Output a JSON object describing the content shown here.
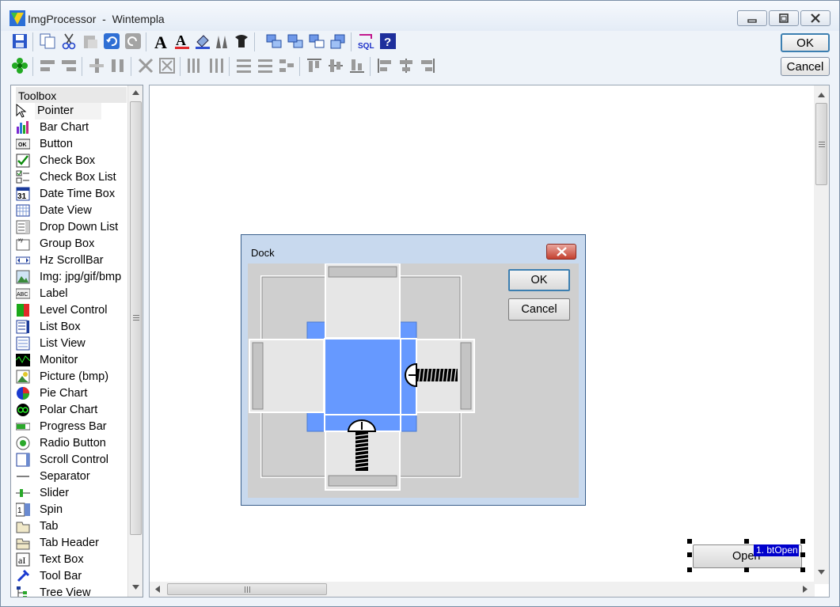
{
  "window": {
    "title": "ImgProcessor  -  Wintempla",
    "controls": [
      "minimize-icon",
      "maximize-icon",
      "close-icon"
    ]
  },
  "toolbar_row1": [
    "save-icon",
    "copy-icon",
    "cut-icon",
    "paste-icon",
    "undo-icon",
    "redo-icon",
    "font-icon",
    "font-color-icon",
    "fill-icon",
    "pen-icon",
    "eraser-icon",
    "bring-front-icon",
    "send-back-icon",
    "swap-icon",
    "move-icon",
    "sql-icon",
    "help-icon"
  ],
  "toolbar_row2": [
    "flower-icon",
    "align-left-edges-icon",
    "align-right-edges-icon",
    "center-horz-icon",
    "center-vert-icon",
    "shrink-icon",
    "expand-icon",
    "space-columns-icon",
    "space-columns-2-icon",
    "space-rows-icon",
    "space-rows-2-icon",
    "space-rows-3-icon",
    "align-top-icon",
    "align-middle-icon",
    "align-bottom-icon",
    "align-left-icon",
    "align-center-icon",
    "align-right-icon"
  ],
  "main_buttons": {
    "ok": "OK",
    "cancel": "Cancel"
  },
  "toolbox": {
    "header": "Toolbox",
    "items": [
      {
        "label": "Pointer",
        "icon": "pointer-icon"
      },
      {
        "label": "Bar Chart",
        "icon": "bar-chart-icon"
      },
      {
        "label": "Button",
        "icon": "button-icon"
      },
      {
        "label": "Check Box",
        "icon": "check-box-icon"
      },
      {
        "label": "Check Box List",
        "icon": "check-box-list-icon"
      },
      {
        "label": "Date Time Box",
        "icon": "date-time-icon"
      },
      {
        "label": "Date View",
        "icon": "date-view-icon"
      },
      {
        "label": "Drop Down List",
        "icon": "drop-down-icon"
      },
      {
        "label": "Group Box",
        "icon": "group-box-icon"
      },
      {
        "label": "Hz ScrollBar",
        "icon": "hz-scrollbar-icon"
      },
      {
        "label": "Img: jpg/gif/bmp",
        "icon": "image-icon"
      },
      {
        "label": "Label",
        "icon": "label-icon"
      },
      {
        "label": "Level Control",
        "icon": "level-control-icon"
      },
      {
        "label": "List Box",
        "icon": "list-box-icon"
      },
      {
        "label": "List View",
        "icon": "list-view-icon"
      },
      {
        "label": "Monitor",
        "icon": "monitor-icon"
      },
      {
        "label": "Picture (bmp)",
        "icon": "picture-icon"
      },
      {
        "label": "Pie Chart",
        "icon": "pie-chart-icon"
      },
      {
        "label": "Polar Chart",
        "icon": "polar-chart-icon"
      },
      {
        "label": "Progress Bar",
        "icon": "progress-bar-icon"
      },
      {
        "label": "Radio Button",
        "icon": "radio-button-icon"
      },
      {
        "label": "Scroll Control",
        "icon": "scroll-control-icon"
      },
      {
        "label": "Separator",
        "icon": "separator-icon"
      },
      {
        "label": "Slider",
        "icon": "slider-icon"
      },
      {
        "label": "Spin",
        "icon": "spin-icon"
      },
      {
        "label": "Tab",
        "icon": "tab-icon"
      },
      {
        "label": "Tab Header",
        "icon": "tab-header-icon"
      },
      {
        "label": "Text Box",
        "icon": "text-box-icon"
      },
      {
        "label": "Tool Bar",
        "icon": "tool-bar-icon"
      },
      {
        "label": "Tree View",
        "icon": "tree-view-icon"
      }
    ]
  },
  "dock_dialog": {
    "title": "Dock",
    "ok": "OK",
    "cancel": "Cancel"
  },
  "canvas": {
    "open_button": "Open",
    "selection_tag": "1. btOpen"
  },
  "colors": {
    "accent": "#6699ff",
    "selection_tag_bg": "#0000cc"
  }
}
